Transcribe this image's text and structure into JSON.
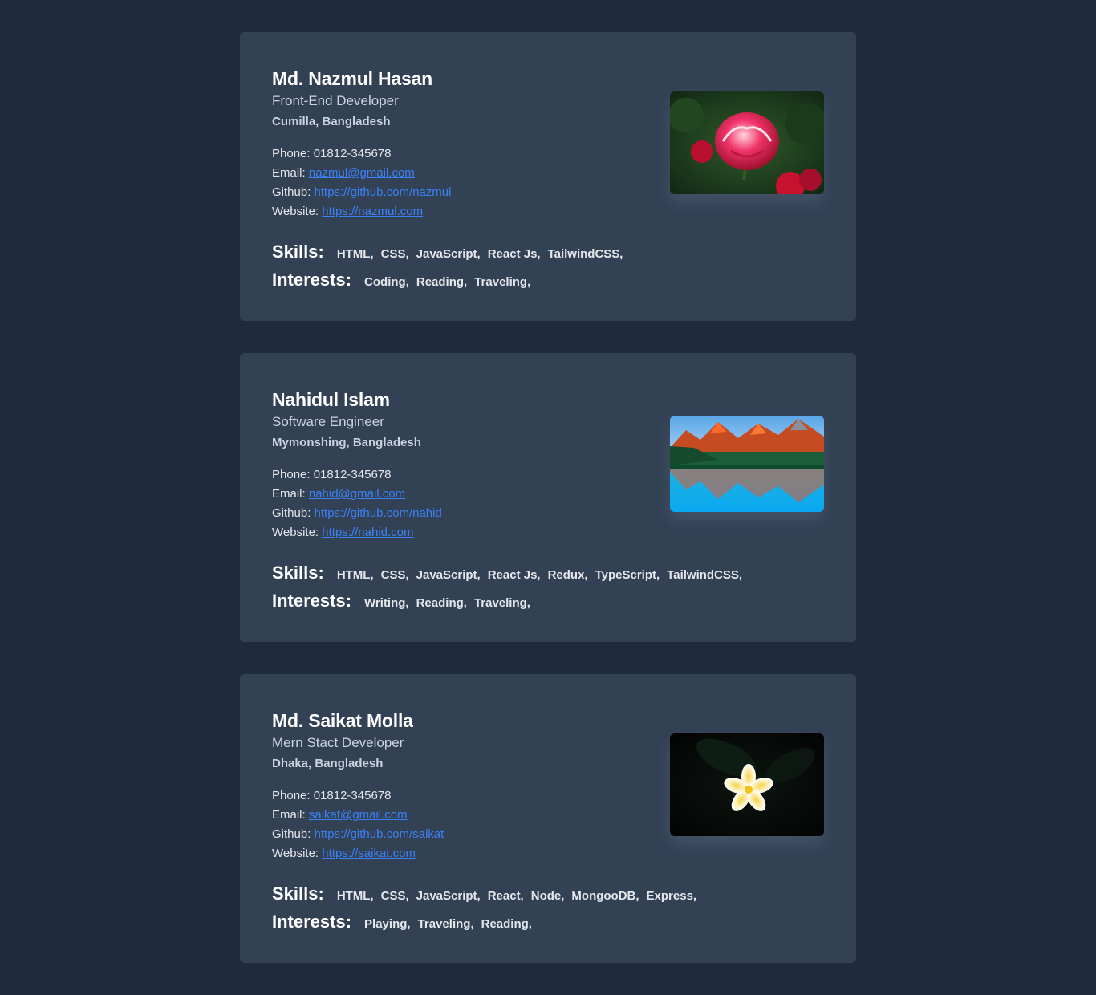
{
  "profiles": [
    {
      "name": "Md. Nazmul Hasan",
      "role": "Front-End Developer",
      "location": "Cumilla, Bangladesh",
      "phone_label": "Phone:",
      "phone": "01812-345678",
      "email_label": "Email:",
      "email": "nazmul@gmail.com",
      "github_label": "Github:",
      "github": "https://github.com/nazmul",
      "website_label": "Website:",
      "website": "https://nazmul.com",
      "skills_label": "Skills:",
      "skills": [
        "HTML,",
        "CSS,",
        "JavaScript,",
        "React Js,",
        "TailwindCSS,"
      ],
      "interests_label": "Interests:",
      "interests": [
        "Coding,",
        "Reading,",
        "Traveling,"
      ],
      "photo": "red-rose-image"
    },
    {
      "name": "Nahidul Islam",
      "role": "Software Engineer",
      "location": "Mymonshing, Bangladesh",
      "phone_label": "Phone:",
      "phone": "01812-345678",
      "email_label": "Email:",
      "email": "nahid@gmail.com",
      "github_label": "Github:",
      "github": "https://github.com/nahid",
      "website_label": "Website:",
      "website": "https://nahid.com",
      "skills_label": "Skills:",
      "skills": [
        "HTML,",
        "CSS,",
        "JavaScript,",
        "React Js,",
        "Redux,",
        "TypeScript,",
        "TailwindCSS,"
      ],
      "interests_label": "Interests:",
      "interests": [
        "Writing,",
        "Reading,",
        "Traveling,"
      ],
      "photo": "mountain-lake-image"
    },
    {
      "name": "Md. Saikat Molla",
      "role": "Mern Stact Developer",
      "location": "Dhaka, Bangladesh",
      "phone_label": "Phone:",
      "phone": "01812-345678",
      "email_label": "Email:",
      "email": "saikat@gmail.com",
      "github_label": "Github:",
      "github": "https://github.com/saikat",
      "website_label": "Website:",
      "website": "https://saikat.com",
      "skills_label": "Skills:",
      "skills": [
        "HTML,",
        "CSS,",
        "JavaScript,",
        "React,",
        "Node,",
        "MongooDB,",
        "Express,"
      ],
      "interests_label": "Interests:",
      "interests": [
        "Playing,",
        "Traveling,",
        "Reading,"
      ],
      "photo": "white-flower-image"
    }
  ],
  "colors": {
    "background": "#1f2a3d",
    "card": "#334155",
    "link": "#3b82f6"
  }
}
